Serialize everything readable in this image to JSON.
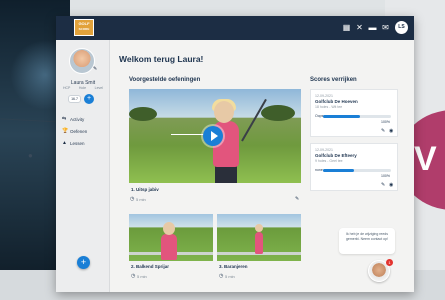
{
  "brand": {
    "logo_text": "GOLF",
    "logo_sub": "SCORE",
    "accent": "#1a7fd6",
    "topbar_color": "#1c2d44",
    "promo_color": "#b03d6b"
  },
  "topbar": {
    "icons": [
      "grid-icon",
      "puzzle-icon",
      "chat-icon",
      "mail-icon"
    ],
    "user_initials": "LS"
  },
  "promo": {
    "letter": "V"
  },
  "sidebar": {
    "user_name": "Laura Smit",
    "stats": [
      {
        "label": "HCP"
      },
      {
        "label": "Hole"
      },
      {
        "label": "Level"
      }
    ],
    "pill_value": "16.7",
    "nav": [
      {
        "icon": "activity-icon",
        "label": "Activity"
      },
      {
        "icon": "trophy-icon",
        "label": "Oefenen"
      },
      {
        "icon": "chart-icon",
        "label": "Lessen"
      }
    ],
    "fab_label": "+"
  },
  "main": {
    "welcome": "Welkom terug Laura!",
    "suggested_title": "Voorgestelde oefeningen",
    "exercise_main": {
      "title": "1. Uitsp jabiv",
      "meta": "5 min"
    },
    "exercise_2": {
      "title": "2. Balkend Sprijar",
      "meta": "5 min"
    },
    "exercise_3": {
      "title": "3. Baranjeren",
      "meta": "5 min"
    }
  },
  "scores": {
    "title": "Scores verrijken",
    "cards": [
      {
        "date": "12-09-2021",
        "title": "Golfclub De Hoeven",
        "subtitle": "18 holes - Wit tee",
        "left": "Oops",
        "right": "100%",
        "fill": 0.55
      },
      {
        "date": "12-09-2021",
        "title": "Golfclub De Efteery",
        "subtitle": "9 holes - Geel tee",
        "left": "none",
        "right": "100%",
        "fill": 0.45
      }
    ]
  },
  "chat": {
    "message": "Ik heb je de wijziging reeds gemerkt. Neem contact op!"
  }
}
